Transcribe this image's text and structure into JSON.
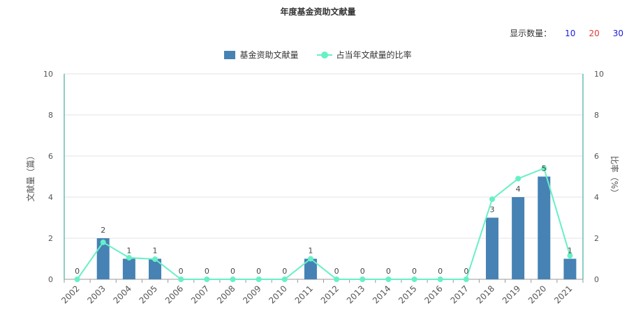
{
  "title": "年度基金资助文献量",
  "count_selector": {
    "label": "显示数量：",
    "options": [
      "10",
      "20",
      "30"
    ]
  },
  "legend": {
    "bar": "基金资助文献量",
    "line": "占当年文献量的比率"
  },
  "colors": {
    "bar": "#4682b4",
    "line": "#66f0c6",
    "axis": "#1a9e8a",
    "grid": "#e3e3e3"
  },
  "chart_data": {
    "type": "bar",
    "title": "年度基金资助文献量",
    "categories": [
      "2002",
      "2003",
      "2004",
      "2005",
      "2006",
      "2007",
      "2008",
      "2009",
      "2010",
      "2011",
      "2012",
      "2013",
      "2014",
      "2015",
      "2016",
      "2017",
      "2018",
      "2019",
      "2020",
      "2021"
    ],
    "series": [
      {
        "name": "基金资助文献量",
        "type": "bar",
        "axis": "left",
        "values": [
          0,
          2,
          1,
          1,
          0,
          0,
          0,
          0,
          0,
          1,
          0,
          0,
          0,
          0,
          0,
          0,
          3,
          4,
          5,
          1
        ]
      },
      {
        "name": "占当年文献量的比率",
        "type": "line",
        "axis": "right",
        "values": [
          0,
          1.8,
          1.05,
          0.98,
          0,
          0,
          0,
          0,
          0,
          1.0,
          0,
          0,
          0,
          0,
          0,
          0,
          3.9,
          4.9,
          5.4,
          1.15
        ]
      }
    ],
    "ylabel_left": "文献量（篇）",
    "ylabel_right": "比率（%）",
    "ylim_left": [
      0,
      10
    ],
    "ylim_right": [
      0,
      10
    ],
    "yticks": [
      "0",
      "2",
      "4",
      "6",
      "8",
      "10"
    ],
    "grid": true,
    "legend_position": "top-center"
  }
}
